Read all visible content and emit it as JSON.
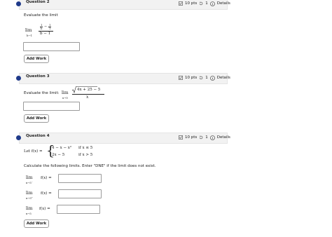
{
  "q2": {
    "title": "Question 2",
    "points": "10 pts",
    "tries": "1",
    "details": "Details",
    "prompt": "Evaluate the limit",
    "lim": "lim",
    "lim_sub": "b→1",
    "num_a_top": "1",
    "num_a_bot": "b",
    "num_b_top": "1",
    "num_b_bot": "1",
    "minus": "−",
    "den": "b − 1",
    "add_work": "Add Work"
  },
  "q3": {
    "title": "Question 3",
    "points": "10 pts",
    "tries": "1",
    "details": "Details",
    "prompt": "Evaluate the limit:",
    "lim": "lim",
    "lim_sub": "x→0",
    "numerator": "4x + 25 − 5",
    "denominator": "x",
    "add_work": "Add Work"
  },
  "q4": {
    "title": "Question 4",
    "points": "10 pts",
    "tries": "1",
    "details": "Details",
    "let": "Let f(x) =",
    "case1_expr": "4 − x − x²",
    "case1_cond": "if  x ≤ 5",
    "case2_expr": "2x − 5",
    "case2_cond": "if  x > 5",
    "instruction": "Calculate the following limits. Enter \"DNE\" if the limit does not exist.",
    "lim": "lim",
    "row1_sub": "x→5⁻",
    "row2_sub": "x→5⁺",
    "row3_sub": "x→5",
    "fx": "f(x) =",
    "add_work": "Add Work"
  }
}
